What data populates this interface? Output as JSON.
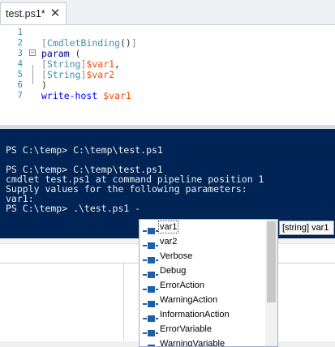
{
  "tab": {
    "title": "test.ps1*",
    "close_glyph": "✕"
  },
  "editor": {
    "line_numbers": [
      "1",
      "2",
      "3",
      "4",
      "5",
      "6",
      "7"
    ],
    "line2": {
      "open": "[",
      "attr": "CmdletBinding",
      "parens": "()",
      "close": "]"
    },
    "line3": {
      "kw": "param",
      "rest": " ("
    },
    "line4": {
      "open": "[",
      "type": "String",
      "close": "]",
      "var": "$var1",
      "comma": ","
    },
    "line5": {
      "open": "[",
      "type": "String",
      "close": "]",
      "var": "$var2"
    },
    "line6": {
      "text": ")"
    },
    "line7": {
      "cmd": "write-host",
      "sp": " ",
      "var": "$var1"
    }
  },
  "console": {
    "lines": [
      "PS C:\\temp> C:\\temp\\test.ps1",
      "",
      "PS C:\\temp> C:\\temp\\test.ps1",
      "cmdlet test.ps1 at command pipeline position 1",
      "Supply values for the following parameters:",
      "var1:",
      "PS C:\\temp> .\\test.ps1 -"
    ]
  },
  "intellisense": {
    "items": [
      "var1",
      "var2",
      "Verbose",
      "Debug",
      "ErrorAction",
      "WarningAction",
      "InformationAction",
      "ErrorVariable",
      "WarningVariable"
    ],
    "selected_index": 0,
    "item_icon": "parameter-icon",
    "tooltip": "[string] var1"
  },
  "colors": {
    "console_bg": "#012456",
    "console_fg": "#eeedf0",
    "line_number": "#2b91af",
    "variable": "#ff4500",
    "keyword": "#00008b",
    "attribute": "#3a8fb5"
  }
}
